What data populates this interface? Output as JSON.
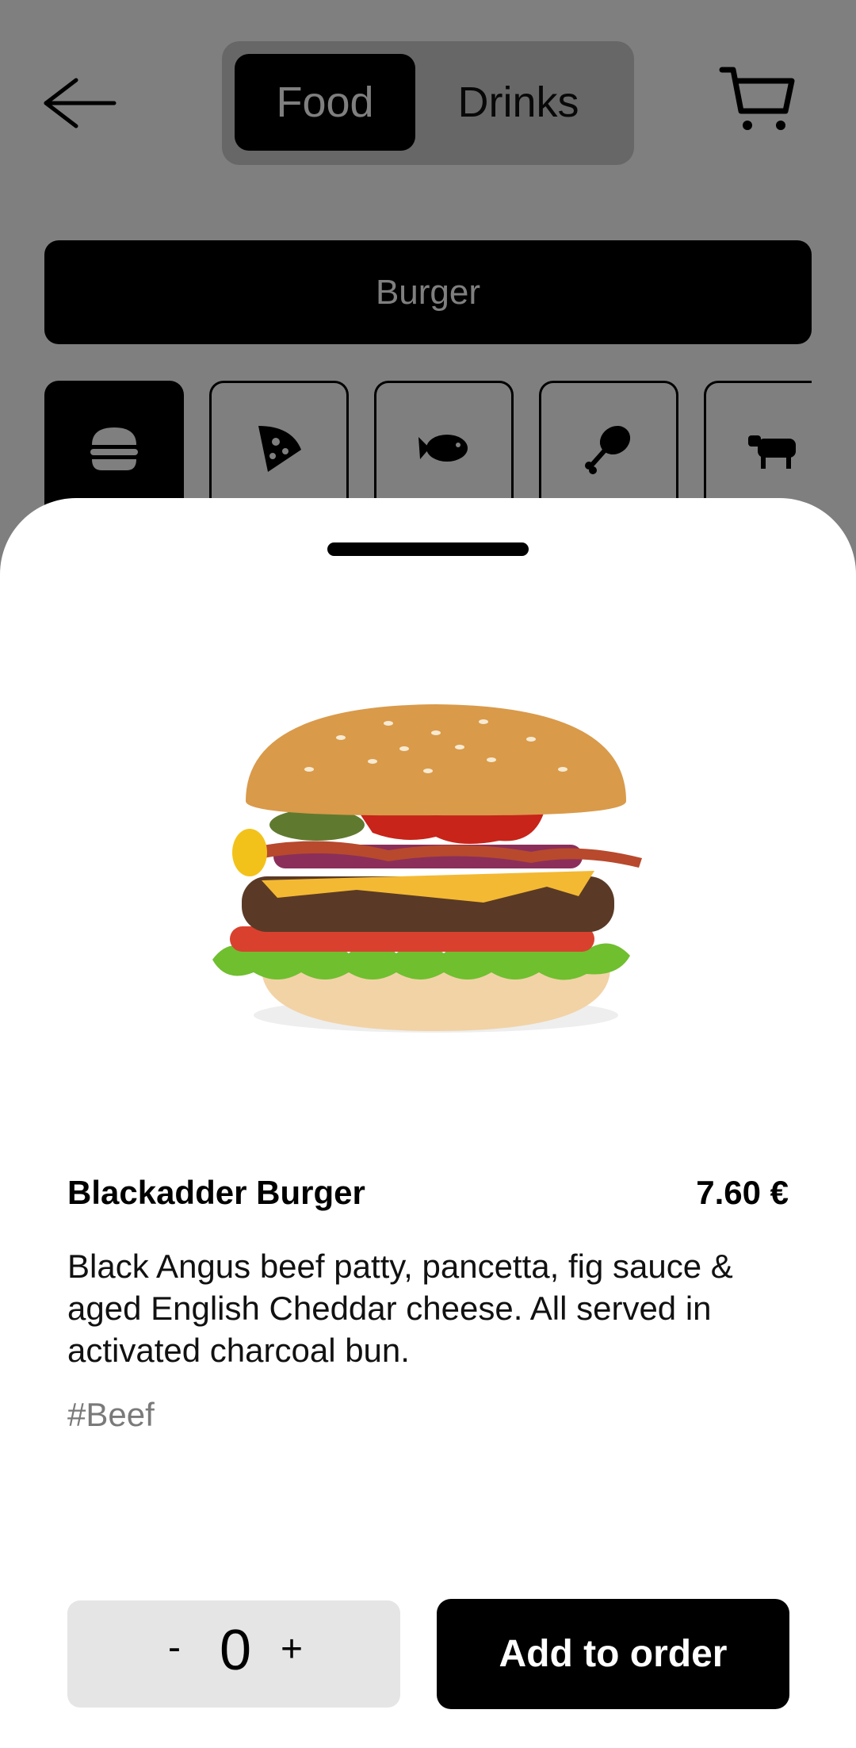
{
  "header": {
    "back_icon": "arrow-left-icon",
    "tabs": [
      {
        "label": "Food",
        "active": true
      },
      {
        "label": "Drinks",
        "active": false
      }
    ],
    "cart_icon": "shopping-cart-icon"
  },
  "category_bar": {
    "label": "Burger"
  },
  "category_tiles": [
    {
      "icon": "burger-icon",
      "active": true
    },
    {
      "icon": "pizza-icon",
      "active": false
    },
    {
      "icon": "fish-icon",
      "active": false
    },
    {
      "icon": "chicken-leg-icon",
      "active": false
    },
    {
      "icon": "cow-icon",
      "active": false
    }
  ],
  "product": {
    "name": "Blackadder Burger",
    "price": "7.60 €",
    "description": "Black Angus beef patty, pancetta, fig sauce & aged English Cheddar cheese. All served in activated charcoal bun.",
    "tag": "#Beef"
  },
  "order": {
    "minus_label": "-",
    "quantity": "0",
    "plus_label": "+",
    "add_button_label": "Add to order"
  },
  "colors": {
    "accent": "#000000",
    "overlay": "#808080",
    "stepper_bg": "#e5e5e5",
    "tag_text": "#7a7a7a"
  }
}
